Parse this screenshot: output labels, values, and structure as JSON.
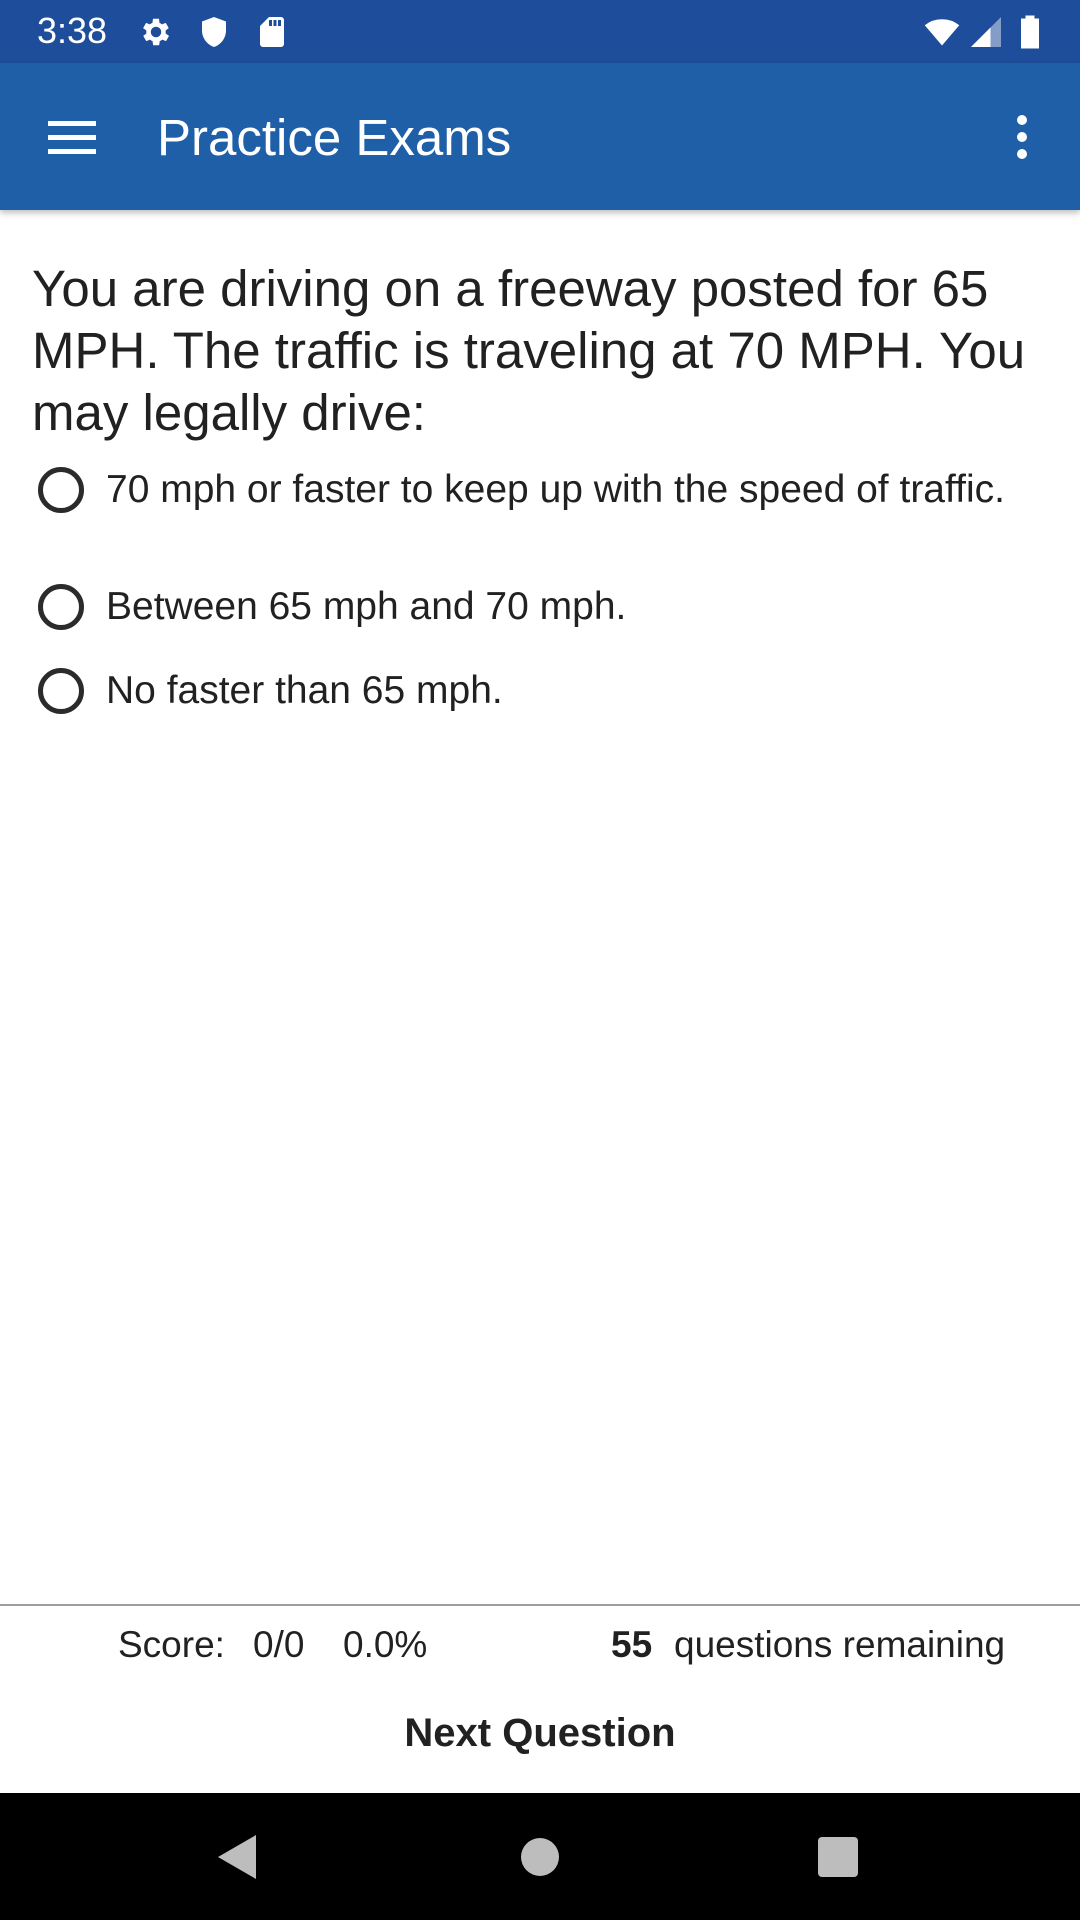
{
  "status_bar": {
    "time": "3:38",
    "left_icons": [
      "settings-icon",
      "shield-icon",
      "sd-card-icon"
    ],
    "right_icons": [
      "wifi-icon",
      "cell-signal-icon",
      "battery-icon"
    ]
  },
  "app_bar": {
    "title": "Practice Exams",
    "menu_icon": "hamburger-menu-icon",
    "overflow_icon": "more-vert-icon"
  },
  "question": {
    "text": "You are driving on a freeway posted for 65 MPH. The traffic is traveling at 70 MPH. You may legally drive:",
    "options": [
      {
        "label": "70 mph or faster to keep up with the speed of traffic.",
        "selected": false
      },
      {
        "label": "Between 65 mph and 70 mph.",
        "selected": false
      },
      {
        "label": "No faster than 65 mph.",
        "selected": false
      }
    ]
  },
  "footer": {
    "score_label": "Score:",
    "score_value": "0/0",
    "score_percent": "0.0%",
    "remaining_count": "55",
    "remaining_label": "questions remaining",
    "next_button": "Next Question"
  },
  "nav_bar": {
    "icons": [
      "back-icon",
      "home-icon",
      "recents-icon"
    ]
  },
  "colors": {
    "status_bar": "#1e4d9b",
    "app_bar": "#1e5fa8",
    "nav_bar": "#000000"
  }
}
